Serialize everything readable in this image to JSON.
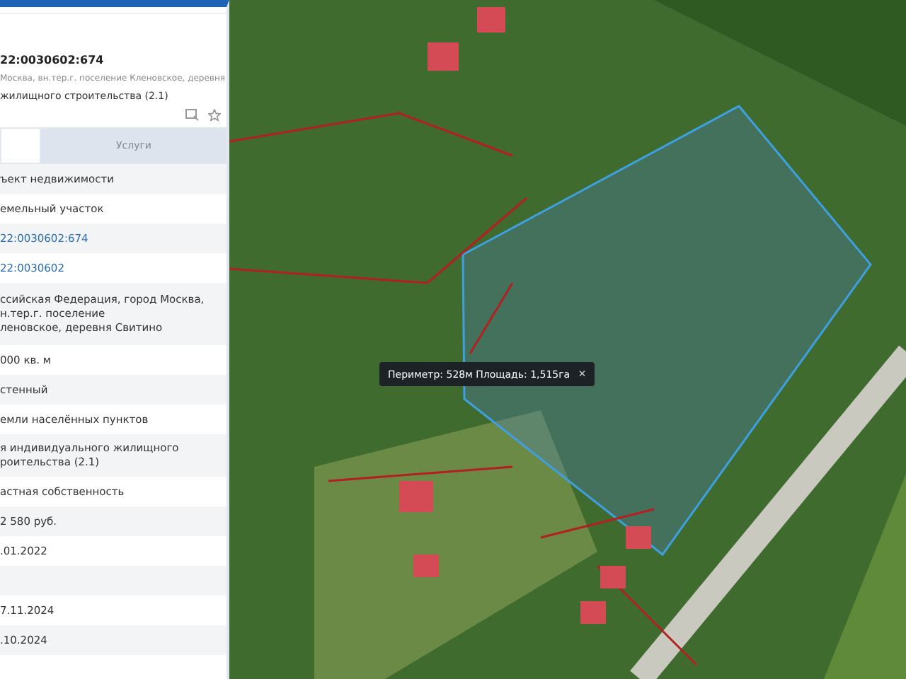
{
  "card": {
    "title": "22:0030602:674",
    "address": "Москва, вн.тер.г. поселение Кленовское, деревня",
    "purpose": "жилищного строительства (2.1)"
  },
  "tabs": [
    {
      "selected": true
    },
    {
      "label": "Услуги",
      "selected": false
    }
  ],
  "rows": [
    {
      "kind": "text",
      "lines": [
        "ъект недвижимости"
      ]
    },
    {
      "kind": "text",
      "lines": [
        "емельный участок"
      ]
    },
    {
      "kind": "link",
      "lines": [
        "22:0030602:674"
      ]
    },
    {
      "kind": "link",
      "lines": [
        "22:0030602"
      ]
    },
    {
      "kind": "text",
      "lines": [
        "ссийская Федерация, город Москва,",
        "н.тер.г. поселение",
        "леновское, деревня Свитино"
      ]
    },
    {
      "kind": "text",
      "lines": [
        "000 кв. м"
      ]
    },
    {
      "kind": "text",
      "lines": [
        "стенный"
      ]
    },
    {
      "kind": "text",
      "lines": [
        "емли населённых пунктов"
      ]
    },
    {
      "kind": "text",
      "lines": [
        "я индивидуального жилищного",
        "роительства (2.1)"
      ]
    },
    {
      "kind": "text",
      "lines": [
        "астная собственность"
      ]
    },
    {
      "kind": "text",
      "lines": [
        "2 580 руб."
      ]
    },
    {
      "kind": "text",
      "lines": [
        ".01.2022"
      ]
    },
    {
      "kind": "text",
      "lines": []
    },
    {
      "kind": "text",
      "lines": [
        "7.11.2024"
      ]
    },
    {
      "kind": "text",
      "lines": [
        ".10.2024"
      ]
    }
  ],
  "map": {
    "tooltip": {
      "text": "Периметр: 528м Площадь: 1,515га",
      "close": "×"
    }
  }
}
